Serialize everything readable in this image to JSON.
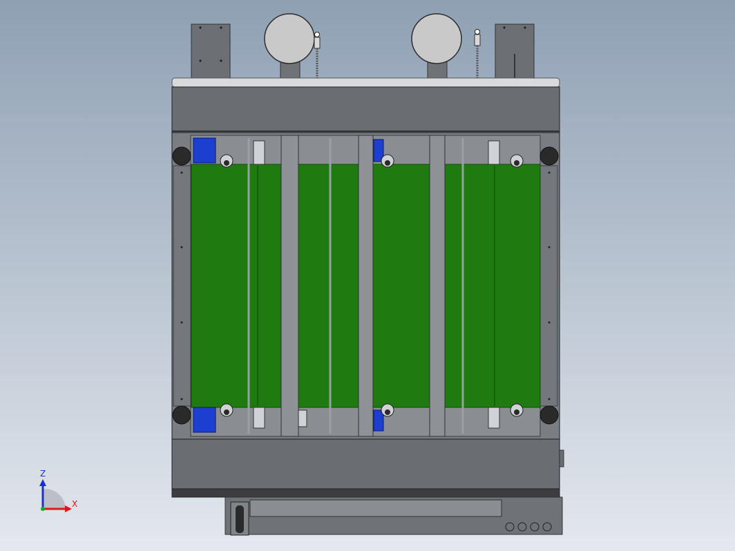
{
  "viewport": {
    "background_top": "#8fa0b4",
    "background_bottom": "#e4e8ee"
  },
  "colors": {
    "frame": "#6a6d72",
    "frame_dark": "#3b3d40",
    "frame_light": "#a8abb0",
    "rail_top": "#d8dadd",
    "belt": "#1f7a10",
    "belt_dark": "#145a08",
    "motor": "#1d3fd0",
    "roller": "#2a2a2a",
    "gauge": "#c9c9c9"
  },
  "machine": {
    "component_icons": [
      "pressure-gauge-icon",
      "spring-valve-icon",
      "drive-motor-icon",
      "idler-roller-icon",
      "caster-wheel-icon"
    ]
  },
  "triad": {
    "z_label": "Z",
    "x_label": "X",
    "z_color": "#1a2fd8",
    "x_color": "#d81a1a",
    "origin_color": "#1aa81a"
  }
}
